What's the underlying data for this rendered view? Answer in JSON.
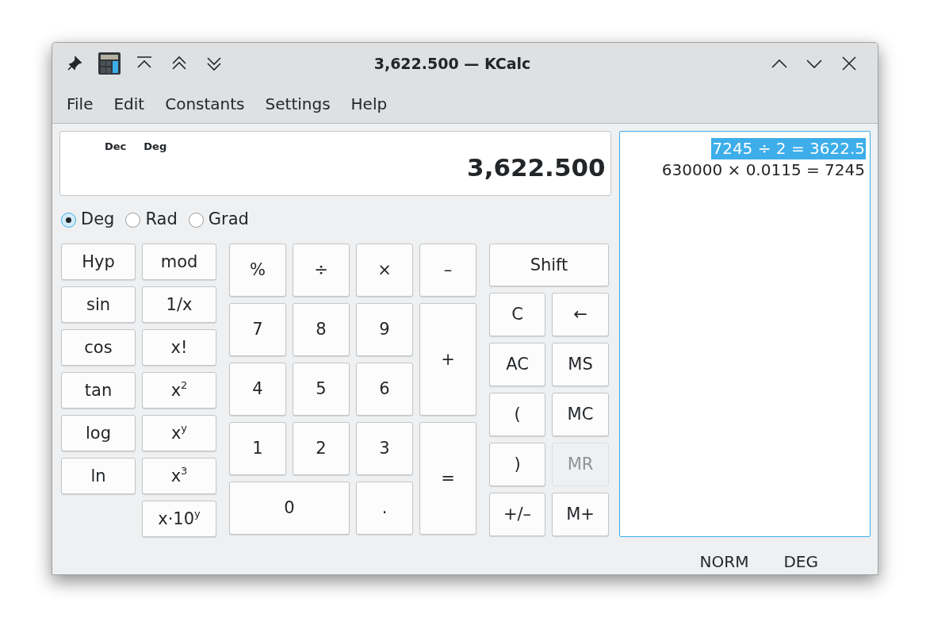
{
  "window": {
    "title": "3,622.500 — KCalc"
  },
  "menu": [
    "File",
    "Edit",
    "Constants",
    "Settings",
    "Help"
  ],
  "display": {
    "indicators": [
      "Dec",
      "Deg"
    ],
    "value": "3,622.500"
  },
  "angle_modes": [
    {
      "label": "Deg",
      "selected": true
    },
    {
      "label": "Rad",
      "selected": false
    },
    {
      "label": "Grad",
      "selected": false
    }
  ],
  "function_keys": [
    {
      "label": "Hyp"
    },
    {
      "label": "mod"
    },
    {
      "label": "sin"
    },
    {
      "label": "1/x"
    },
    {
      "label": "cos"
    },
    {
      "label": "x!"
    },
    {
      "label": "tan"
    },
    {
      "label": "x$^{2}$"
    },
    {
      "label": "log"
    },
    {
      "label": "x$^{y}$"
    },
    {
      "label": "ln"
    },
    {
      "label": "x$^{3}$"
    },
    {
      "label": "x·10$^{y}$",
      "kind": "offset"
    }
  ],
  "number_keys": [
    {
      "label": "%",
      "kind": "normal"
    },
    {
      "label": "÷",
      "kind": "normal"
    },
    {
      "label": "×",
      "kind": "normal"
    },
    {
      "label": "–",
      "kind": "normal"
    },
    {
      "label": "7",
      "kind": "normal"
    },
    {
      "label": "8",
      "kind": "normal"
    },
    {
      "label": "9",
      "kind": "normal"
    },
    {
      "label": "+",
      "kind": "tall"
    },
    {
      "label": "4",
      "kind": "normal"
    },
    {
      "label": "5",
      "kind": "normal"
    },
    {
      "label": "6",
      "kind": "normal"
    },
    {
      "label": "1",
      "kind": "normal"
    },
    {
      "label": "2",
      "kind": "normal"
    },
    {
      "label": "3",
      "kind": "normal"
    },
    {
      "label": "=",
      "kind": "tall"
    },
    {
      "label": "0",
      "kind": "wide"
    },
    {
      "label": ".",
      "kind": "normal"
    }
  ],
  "memory_keys": [
    {
      "label": "Shift",
      "kind": "wide",
      "disabled": false
    },
    {
      "label": "C",
      "kind": "normal",
      "disabled": false
    },
    {
      "label": "←",
      "kind": "normal",
      "disabled": false
    },
    {
      "label": "AC",
      "kind": "normal",
      "disabled": false
    },
    {
      "label": "MS",
      "kind": "normal",
      "disabled": false
    },
    {
      "label": "(",
      "kind": "normal",
      "disabled": false
    },
    {
      "label": "MC",
      "kind": "normal",
      "disabled": false
    },
    {
      "label": ")",
      "kind": "normal",
      "disabled": false
    },
    {
      "label": "MR",
      "kind": "normal",
      "disabled": true
    },
    {
      "label": "+/–",
      "kind": "normal",
      "disabled": false
    },
    {
      "label": "M+",
      "kind": "normal",
      "disabled": false
    }
  ],
  "history": [
    {
      "text": "7245 ÷ 2 = 3622.5",
      "selected": true
    },
    {
      "text": "630000 × 0.0115 = 7245",
      "selected": false
    }
  ],
  "status_bar": [
    "NORM",
    "DEG"
  ]
}
